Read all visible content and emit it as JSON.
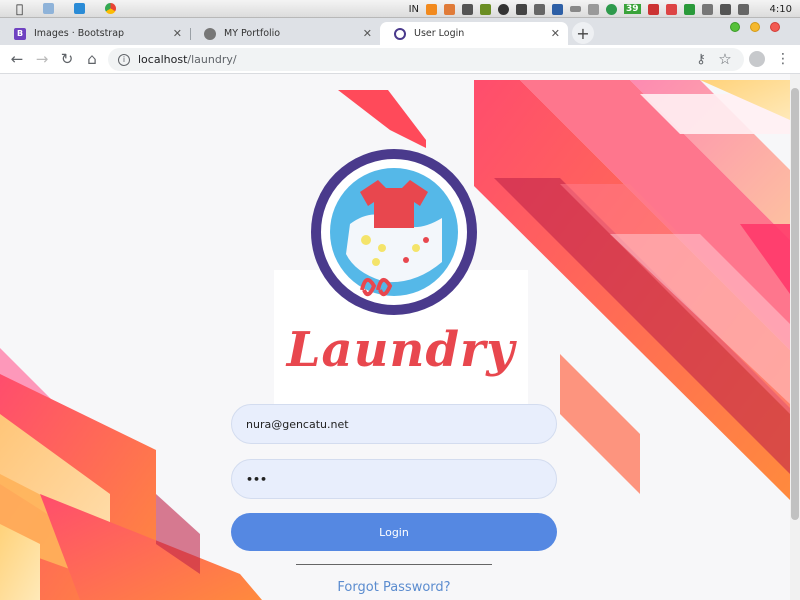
{
  "menubar": {
    "input_indicator": "IN",
    "badge_count": "39",
    "clock": "4:10"
  },
  "tabs": [
    {
      "label": "Images · Bootstrap",
      "favicon_letter": "B"
    },
    {
      "label": "MY Portfolio"
    },
    {
      "label": "User Login"
    }
  ],
  "address": {
    "host": "localhost",
    "path": "/laundry/"
  },
  "logo": {
    "text": "Laundry"
  },
  "form": {
    "email_value": "nura@gencatu.net",
    "password_value": "•••",
    "login_label": "Login",
    "forgot_label": "Forgot Password?"
  },
  "colors": {
    "accent_blue": "#5588e2",
    "logo_red": "#e8474e",
    "logo_purple": "#4a3a8c",
    "logo_cyan": "#55b8e8"
  }
}
